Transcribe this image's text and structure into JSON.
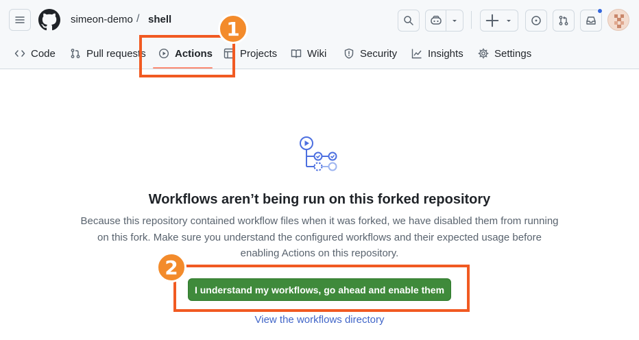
{
  "header": {
    "owner": "simeon-demo",
    "separator": "/",
    "repo": "shell"
  },
  "tabs": [
    {
      "label": "Code",
      "icon": "code-icon"
    },
    {
      "label": "Pull requests",
      "icon": "git-pull-request-icon"
    },
    {
      "label": "Actions",
      "icon": "play-icon",
      "active": true
    },
    {
      "label": "Projects",
      "icon": "table-icon"
    },
    {
      "label": "Wiki",
      "icon": "book-icon"
    },
    {
      "label": "Security",
      "icon": "shield-icon"
    },
    {
      "label": "Insights",
      "icon": "graph-icon"
    },
    {
      "label": "Settings",
      "icon": "gear-icon"
    }
  ],
  "annotations": {
    "step1": "1",
    "step2": "2",
    "color": "#f15a22"
  },
  "blankslate": {
    "title": "Workflows aren’t being run on this forked repository",
    "description": "Because this repository contained workflow files when it was forked, we have disabled them from running on this fork. Make sure you understand the configured workflows and their expected usage before enabling Actions on this repository.",
    "enable_button": "I understand my workflows, go ahead and enable them",
    "view_link": "View the workflows directory"
  },
  "colors": {
    "accent_underline": "#fd8c73",
    "primary_button": "#3f8a3b",
    "link": "#4065c8",
    "notification_dot": "#3366dd"
  }
}
